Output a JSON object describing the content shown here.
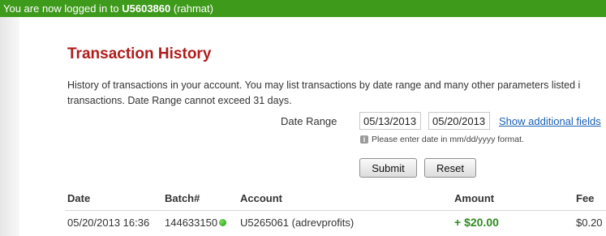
{
  "login_bar": {
    "prefix": "You are now logged in to ",
    "account_id": "U5603860",
    "user": " (rahmat)"
  },
  "page": {
    "title": "Transaction History",
    "intro_line1": "History of transactions in your account. You may list transactions by date range and many other parameters listed i",
    "intro_line2": "transactions. Date Range cannot exceed 31 days."
  },
  "filter": {
    "date_range_label": "Date Range",
    "from_date": "05/13/2013",
    "to_date": "05/20/2013",
    "show_additional_fields": "Show additional fields",
    "hint": "Please enter date in mm/dd/yyyy format.",
    "info_icon_glyph": "i"
  },
  "buttons": {
    "submit": "Submit",
    "reset": "Reset"
  },
  "table": {
    "headers": {
      "date": "Date",
      "batch": "Batch#",
      "account": "Account",
      "amount": "Amount",
      "fee": "Fee"
    },
    "rows": [
      {
        "date": "05/20/2013 16:36",
        "batch": "144633150",
        "account": "U5265061 (adrevprofits)",
        "amount": "+ $20.00",
        "fee": "$0.20",
        "status_color": "#2bb01a"
      }
    ]
  },
  "colors": {
    "login_bar": "#3e9a1b",
    "title": "#b01c1c",
    "link": "#1a5fb4",
    "amount_positive": "#2e8b1e"
  }
}
